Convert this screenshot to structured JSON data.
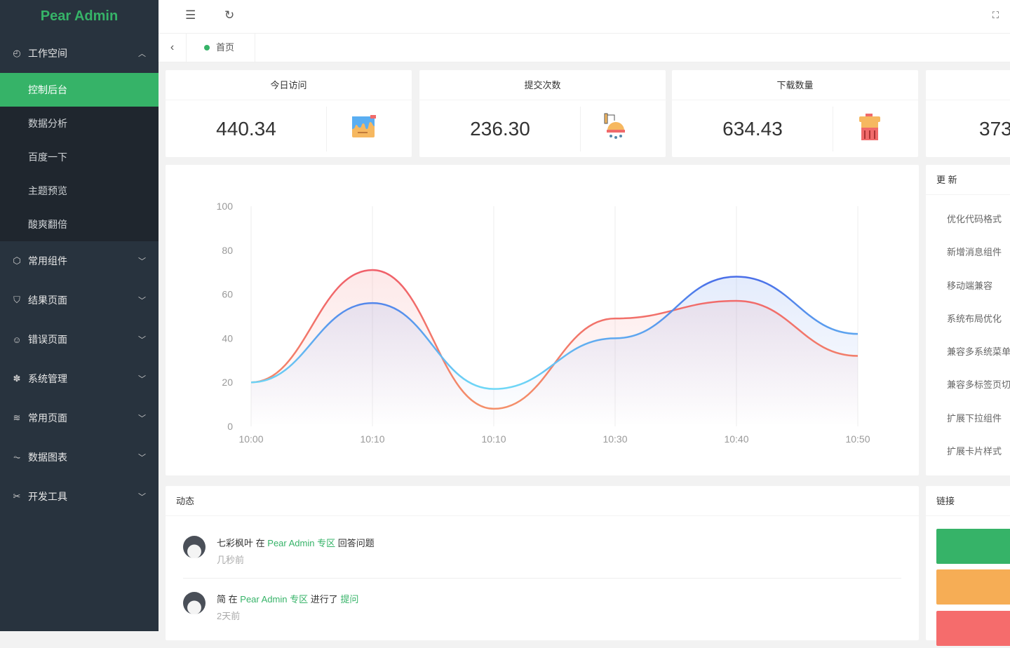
{
  "app": {
    "title": "Pear Admin",
    "accent": "#36b368"
  },
  "sidebar": {
    "workspace": {
      "label": "工作空间",
      "icon": "dashboard-icon",
      "items": [
        "控制后台",
        "数据分析",
        "百度一下",
        "主题预览",
        "酸爽翻倍"
      ],
      "active": "控制后台"
    },
    "menus": [
      {
        "label": "常用组件",
        "icon": "cube-icon"
      },
      {
        "label": "结果页面",
        "icon": "shield-check-icon"
      },
      {
        "label": "错误页面",
        "icon": "smile-icon"
      },
      {
        "label": "系统管理",
        "icon": "gear-icon"
      },
      {
        "label": "常用页面",
        "icon": "layers-icon"
      },
      {
        "label": "数据图表",
        "icon": "pulse-icon"
      },
      {
        "label": "开发工具",
        "icon": "tools-icon"
      }
    ]
  },
  "tabs": [
    {
      "label": "首页"
    }
  ],
  "stats": [
    {
      "title": "今日访问",
      "value": "440.34",
      "icon": "paint-bucket-icon"
    },
    {
      "title": "提交次数",
      "value": "236.30",
      "icon": "shower-icon"
    },
    {
      "title": "下载数量",
      "value": "634.43",
      "icon": "trash-bin-icon"
    },
    {
      "title": "",
      "value": "373"
    }
  ],
  "chart_data": {
    "type": "area",
    "categories": [
      "10:00",
      "10:10",
      "10:10",
      "10:30",
      "10:40",
      "10:50"
    ],
    "ylim": [
      0,
      100
    ],
    "yticks": [
      0,
      20,
      40,
      60,
      80,
      100
    ],
    "grid": "vertical",
    "smooth": true,
    "series": [
      {
        "values": [
          20,
          71,
          8,
          49,
          57,
          32
        ],
        "color": "#f06a6a"
      },
      {
        "values": [
          20,
          56,
          17,
          40,
          68,
          42
        ],
        "color": "#4a7eea"
      }
    ]
  },
  "updates": {
    "title": "更 新",
    "items": [
      "优化代码格式",
      "新增消息组件",
      "移动端兼容",
      "系统布局优化",
      "兼容多系统菜单",
      "兼容多标签页切",
      "扩展下拉组件",
      "扩展卡片样式"
    ]
  },
  "activity": {
    "title": "动态",
    "items": [
      {
        "user": "七彩枫叶",
        "at": "在",
        "zone": "Pear Admin 专区",
        "action": "回答问题",
        "link": "",
        "time": "几秒前"
      },
      {
        "user": "简",
        "at": "在",
        "zone": "Pear Admin 专区",
        "action": "进行了",
        "link": "提问",
        "time": "2天前"
      }
    ]
  },
  "links": {
    "title": "链接",
    "colors": [
      "#36b368",
      "#f6ad55",
      "#f56c6c"
    ]
  }
}
